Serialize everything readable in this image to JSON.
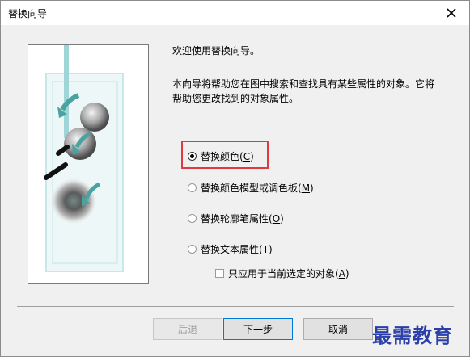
{
  "window": {
    "title": "替换向导"
  },
  "intro": "欢迎使用替换向导。",
  "description_lines": [
    "本向导将帮助您在图中搜索和查找具有某些属性的对象。它将",
    "帮助您更改找到的对象属性。"
  ],
  "options": [
    {
      "label": "替换颜色(",
      "key": "C",
      "suffix": ")",
      "selected": true
    },
    {
      "label": "替换颜色模型或调色板(",
      "key": "M",
      "suffix": ")",
      "selected": false
    },
    {
      "label": "替换轮廓笔属性(",
      "key": "O",
      "suffix": ")",
      "selected": false
    },
    {
      "label": "替换文本属性(",
      "key": "T",
      "suffix": ")",
      "selected": false
    }
  ],
  "checkbox": {
    "label": "只应用于当前选定的对象(",
    "key": "A",
    "suffix": ")",
    "checked": false
  },
  "buttons": {
    "back": "后退",
    "next": "下一步",
    "cancel": "取消"
  },
  "watermark": "最需教育",
  "colors": {
    "accent": "#e03a3e",
    "default_button_border": "#0078d7",
    "teal": "#4aa3a0"
  }
}
